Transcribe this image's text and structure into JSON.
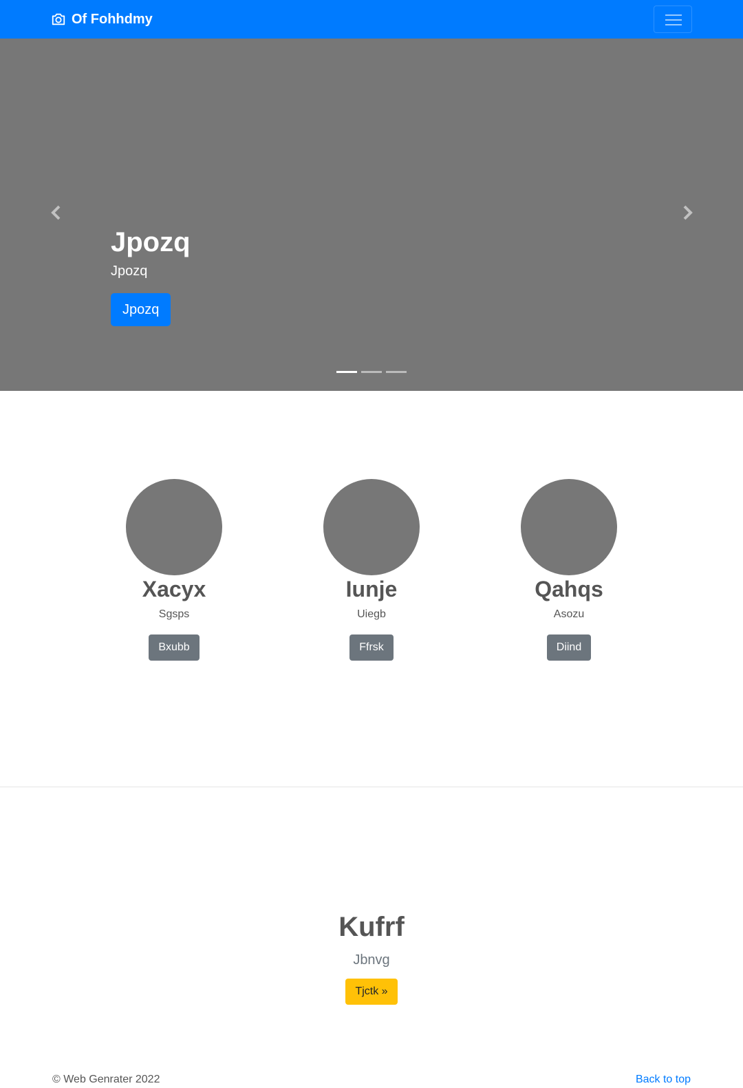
{
  "colors": {
    "primary": "#007bff",
    "secondary": "#6c757d",
    "warning": "#ffc107",
    "placeholder": "#777777"
  },
  "navbar": {
    "brand_icon": "camera-icon",
    "brand": "Of Fohhdmy",
    "toggler_icon": "hamburger-icon"
  },
  "carousel": {
    "prev_icon": "chevron-left-icon",
    "next_icon": "chevron-right-icon",
    "title": "Jpozq",
    "text": "Jpozq",
    "button": "Jpozq",
    "slide_count": 3,
    "active_slide": 1
  },
  "features": [
    {
      "title": "Xacyx",
      "text": "Sgsps",
      "button": "Bxubb"
    },
    {
      "title": "Iunje",
      "text": "Uiegb",
      "button": "Ffrsk"
    },
    {
      "title": "Qahqs",
      "text": "Asozu",
      "button": "Diind"
    }
  ],
  "jumbotron": {
    "title": "Kufrf",
    "text": "Jbnvg",
    "button": "Tjctk »"
  },
  "footer": {
    "copyright": "© Web Genrater 2022",
    "back_to_top": "Back to top"
  }
}
